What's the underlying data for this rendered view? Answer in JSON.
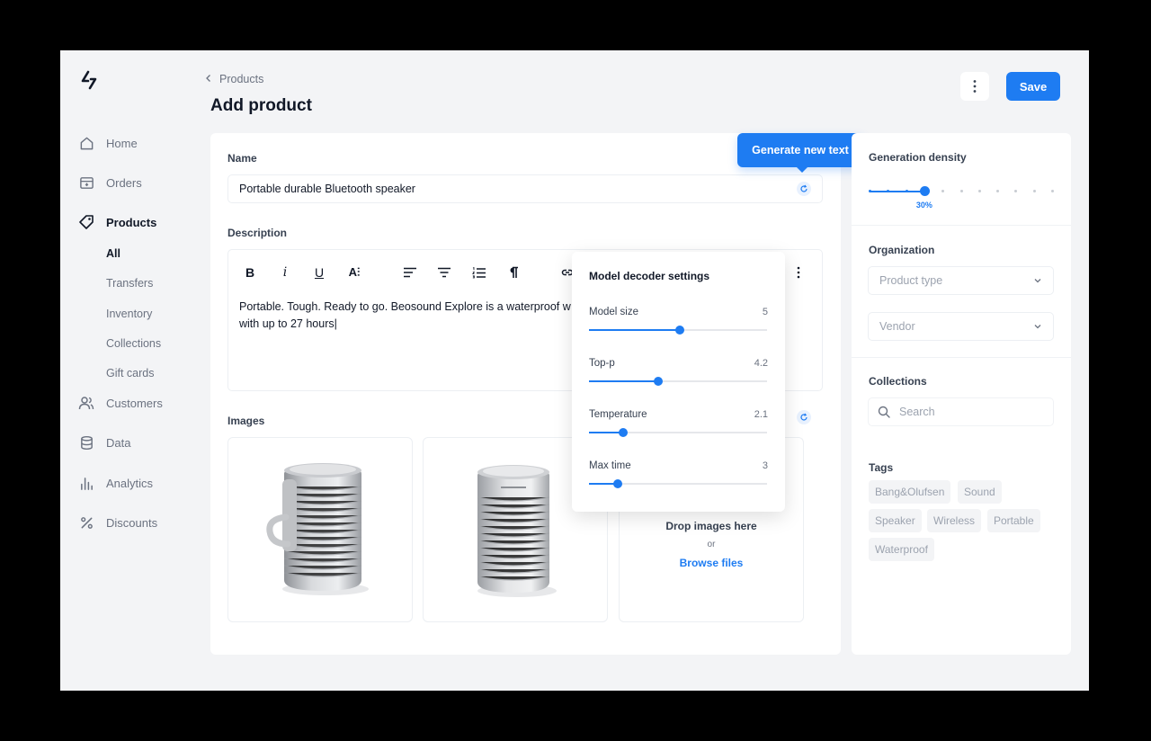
{
  "sidebar": {
    "logo": "logo-icon",
    "items": [
      {
        "label": "Home",
        "icon": "home-icon"
      },
      {
        "label": "Orders",
        "icon": "orders-icon"
      },
      {
        "label": "Products",
        "icon": "tag-icon"
      },
      {
        "label": "Customers",
        "icon": "users-icon"
      },
      {
        "label": "Data",
        "icon": "database-icon"
      },
      {
        "label": "Analytics",
        "icon": "bar-chart-icon"
      },
      {
        "label": "Discounts",
        "icon": "percent-icon"
      }
    ],
    "product_subitems": [
      "All",
      "Transfers",
      "Inventory",
      "Collections",
      "Gift cards"
    ],
    "active_item": "Products",
    "active_subitem": "All"
  },
  "header": {
    "breadcrumb": "Products",
    "title": "Add product",
    "save_label": "Save"
  },
  "form": {
    "name_label": "Name",
    "name_value": "Portable durable Bluetooth speaker",
    "description_label": "Description",
    "description_value": "Portable. Tough. Ready to go. Beosound Explore is a waterproof w with up to 27 hours|",
    "description_lines": [
      "Portable. Tough. Ready to go. Beosound Explore is a waterproof w",
      "with up to 27 hours|"
    ],
    "toolbar": {
      "bold": "B",
      "italic": "i",
      "underline": "U",
      "font_size": "A⫶"
    },
    "images_label": "Images",
    "dropzone": {
      "title": "Drop images here",
      "or": "or",
      "link": "Browse files"
    }
  },
  "generate_tooltip": "Generate new text",
  "decoder": {
    "title": "Model decoder settings",
    "settings": [
      {
        "label": "Model size",
        "value": "5",
        "fraction": 0.51
      },
      {
        "label": "Top-p",
        "value": "4.2",
        "fraction": 0.39
      },
      {
        "label": "Temperature",
        "value": "2.1",
        "fraction": 0.19
      },
      {
        "label": "Max time",
        "value": "3",
        "fraction": 0.16
      }
    ]
  },
  "right_panel": {
    "density_label": "Generation density",
    "density_value": "30%",
    "density_fraction": 0.3,
    "organization_label": "Organization",
    "product_type_placeholder": "Product type",
    "vendor_placeholder": "Vendor",
    "collections_label": "Collections",
    "search_placeholder": "Search",
    "tags_label": "Tags",
    "tags": [
      "Bang&Olufsen",
      "Sound",
      "Speaker",
      "Wireless",
      "Portable",
      "Waterproof"
    ]
  },
  "colors": {
    "accent": "#1e7cf2",
    "background": "#f3f4f6",
    "card": "#ffffff"
  }
}
